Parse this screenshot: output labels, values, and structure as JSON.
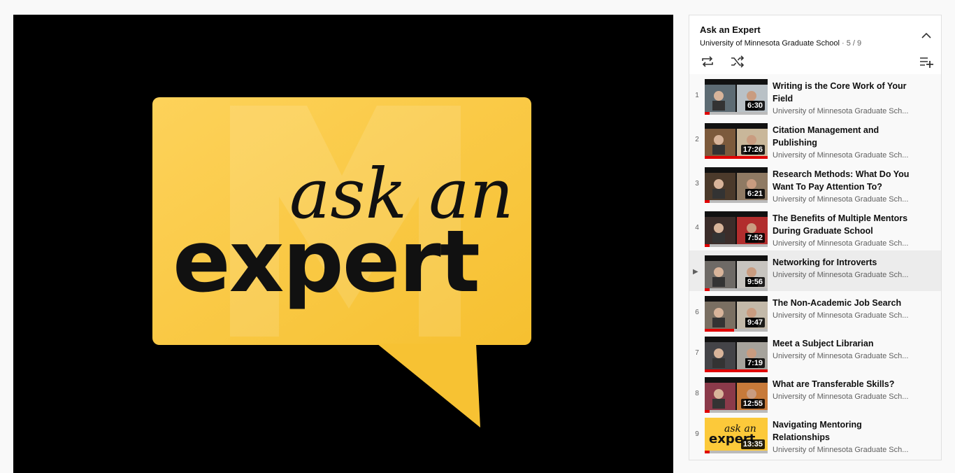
{
  "player": {
    "logo_line1": "ask an",
    "logo_line2": "expert"
  },
  "playlist": {
    "title": "Ask an Expert",
    "channel": "University of Minnesota Graduate School",
    "position": "5 / 9",
    "separator": "·",
    "icons": {
      "collapse": "chevron-up-icon",
      "loop": "loop-icon",
      "shuffle": "shuffle-icon",
      "save": "playlist-add-icon"
    },
    "current_indicator": "▶",
    "items": [
      {
        "index": "1",
        "title": "Writing is the Core Work of Your Field",
        "channel": "University of Minnesota Graduate Sch...",
        "duration": "6:30",
        "watched": 0.08
      },
      {
        "index": "2",
        "title": "Citation Management and Publishing",
        "channel": "University of Minnesota Graduate Sch...",
        "duration": "17:26",
        "watched": 1.0
      },
      {
        "index": "3",
        "title": "Research Methods: What Do You Want To Pay Attention To?",
        "channel": "University of Minnesota Graduate Sch...",
        "duration": "6:21",
        "watched": 0.08
      },
      {
        "index": "4",
        "title": "The Benefits of Multiple Mentors During Graduate School",
        "channel": "University of Minnesota Graduate Sch...",
        "duration": "7:52",
        "watched": 0.08
      },
      {
        "index": "5",
        "title": "Networking for Introverts",
        "channel": "University of Minnesota Graduate Sch...",
        "duration": "9:56",
        "watched": 0.08
      },
      {
        "index": "6",
        "title": "The Non-Academic Job Search",
        "channel": "University of Minnesota Graduate Sch...",
        "duration": "9:47",
        "watched": 0.47
      },
      {
        "index": "7",
        "title": "Meet a Subject Librarian",
        "channel": "University of Minnesota Graduate Sch...",
        "duration": "7:19",
        "watched": 1.0
      },
      {
        "index": "8",
        "title": "What are Transferable Skills?",
        "channel": "University of Minnesota Graduate Sch...",
        "duration": "12:55",
        "watched": 0.08
      },
      {
        "index": "9",
        "title": "Navigating Mentoring Relationships",
        "channel": "University of Minnesota Graduate Sch...",
        "duration": "13:35",
        "watched": 0.08
      }
    ]
  },
  "colors": {
    "logo_yellow": "#fcc93a",
    "progress_red": "#e00000"
  }
}
